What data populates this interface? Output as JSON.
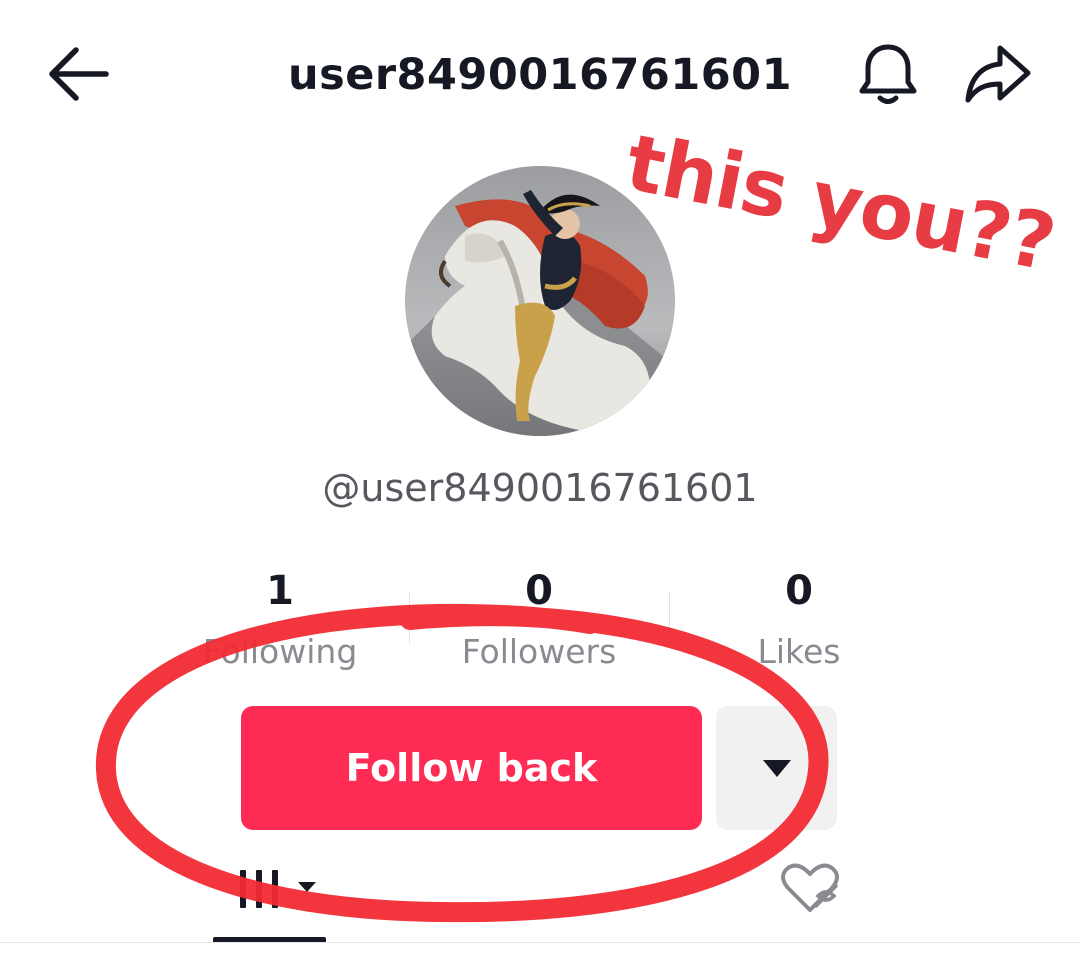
{
  "header": {
    "title": "user8490016761601",
    "icons": {
      "back": "arrow-left-icon",
      "notifications": "bell-icon",
      "share": "share-arrow-icon"
    }
  },
  "profile": {
    "handle": "@user8490016761601",
    "avatar": "avatar-painting"
  },
  "stats": [
    {
      "value": "1",
      "label": "Following"
    },
    {
      "value": "0",
      "label": "Followers"
    },
    {
      "value": "0",
      "label": "Likes"
    }
  ],
  "actions": {
    "follow_label": "Follow back",
    "dropdown_icon": "caret-down-icon"
  },
  "tabs": {
    "videos_icon": "grid-bars-icon",
    "liked_icon": "hidden-heart-icon",
    "active": "videos"
  },
  "annotation": {
    "text": "this you??",
    "color": "#e83c45"
  },
  "colors": {
    "accent": "#fe2c55",
    "text_primary": "#161823",
    "text_secondary": "#8a8b91"
  }
}
